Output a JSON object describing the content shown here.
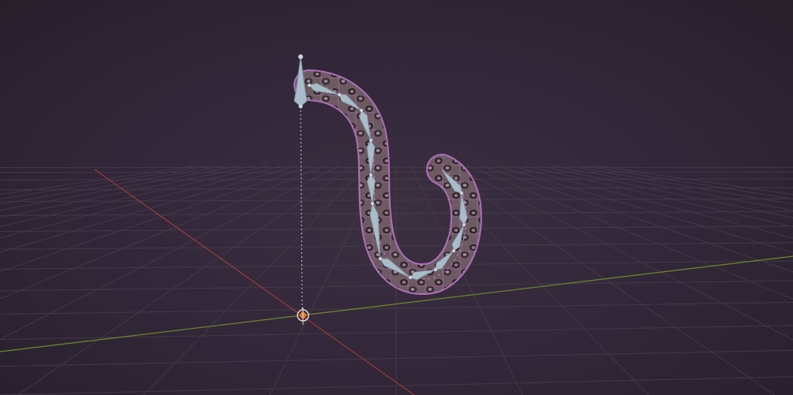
{
  "viewport": {
    "background": "#2f2631",
    "grid_color": "#4a3f4f",
    "x_axis_color": "#b83a3a",
    "y_axis_color": "#7d9a2a",
    "mesh_wire_color": "#c57ad0",
    "bone_color": "#a9bcc9",
    "origin_color": "#e07b2a"
  },
  "scene": {
    "objects": [
      {
        "name": "snake-mesh",
        "type": "mesh",
        "selected": true
      },
      {
        "name": "snake-armature",
        "type": "armature",
        "bones": 12
      },
      {
        "name": "ik-control-bone",
        "type": "bone"
      }
    ],
    "icons": [
      "origin-gizmo-icon",
      "bone-icon"
    ]
  }
}
